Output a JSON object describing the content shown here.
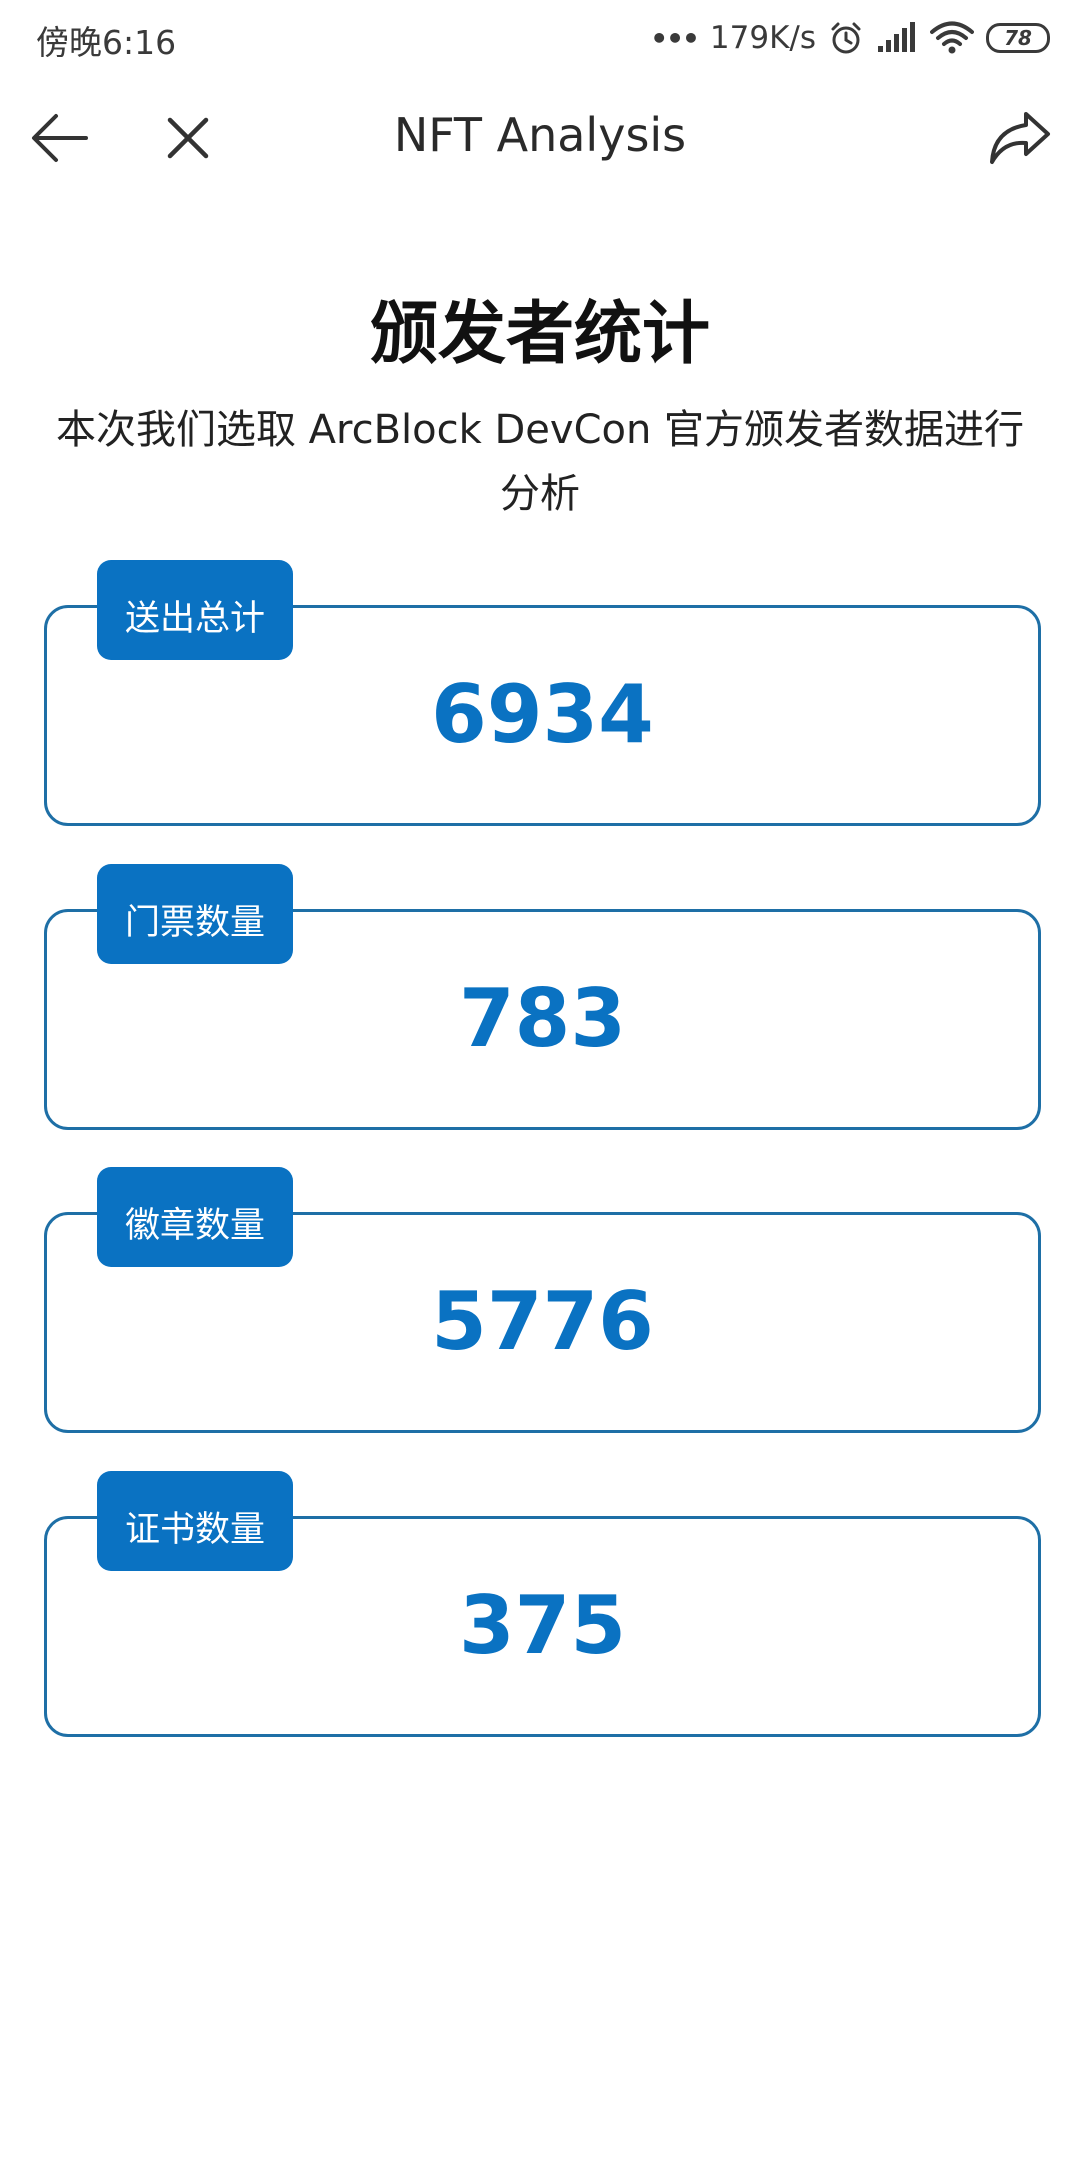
{
  "status_bar": {
    "time": "傍晚6:16",
    "dots": "•••",
    "network_speed": "179K/s",
    "battery_level": "78",
    "icons": [
      "alarm-icon",
      "signal-icon",
      "wifi-icon",
      "battery-icon"
    ]
  },
  "nav": {
    "title": "NFT Analysis",
    "icons": [
      "back-arrow-icon",
      "close-icon",
      "share-icon"
    ]
  },
  "page": {
    "title": "颁发者统计",
    "subtitle": "本次我们选取 ArcBlock DevCon 官方颁发者数据进行分析"
  },
  "stats": [
    {
      "label": "送出总计",
      "value": "6934"
    },
    {
      "label": "门票数量",
      "value": "783"
    },
    {
      "label": "徽章数量",
      "value": "5776"
    },
    {
      "label": "证书数量",
      "value": "375"
    }
  ],
  "colors": {
    "accent": "#0a72c2",
    "card_border": "#1e6fa6",
    "background": "#ffffff"
  }
}
